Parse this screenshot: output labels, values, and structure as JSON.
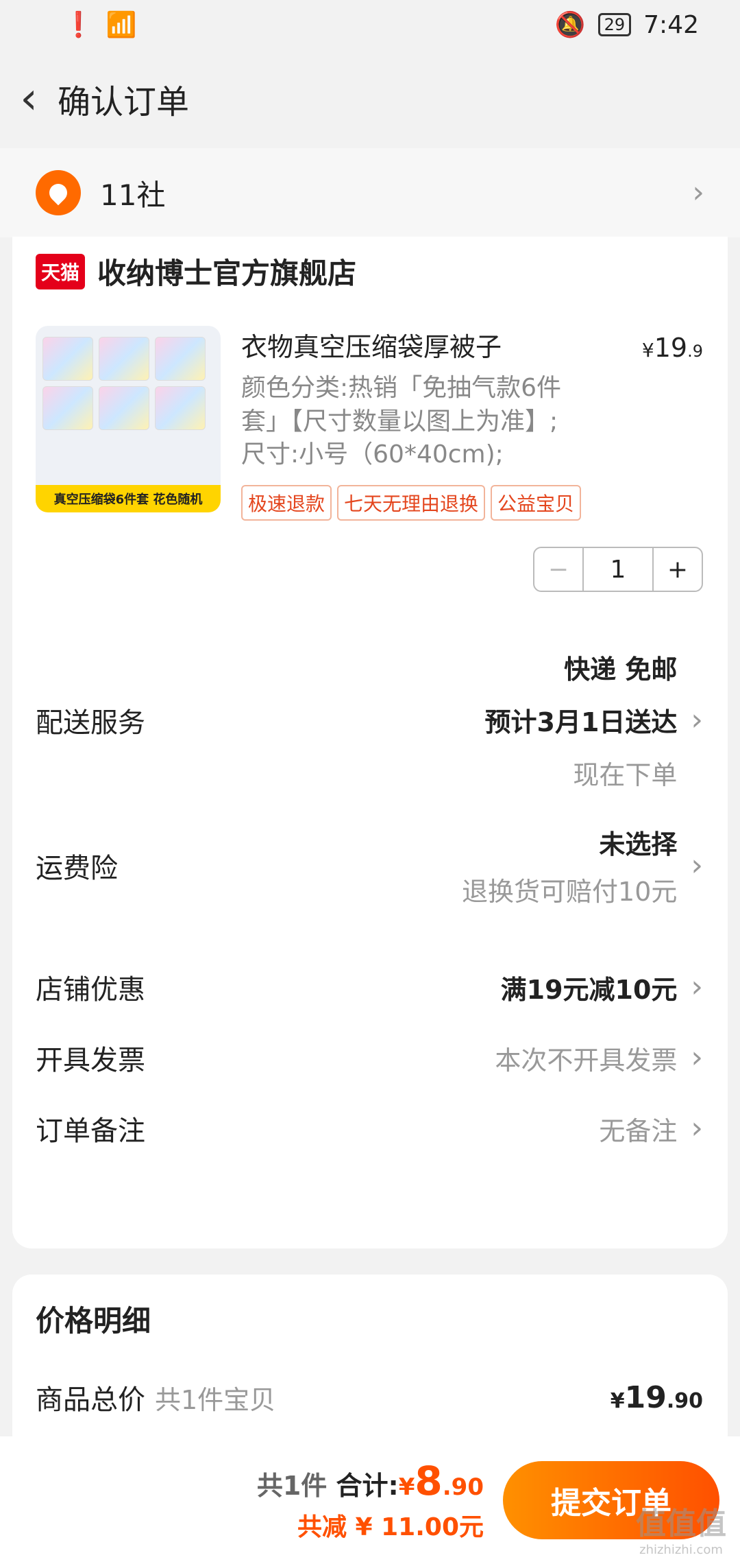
{
  "status": {
    "time": "7:42",
    "battery": "29"
  },
  "header": {
    "title": "确认订单"
  },
  "address": {
    "text": "11社"
  },
  "store": {
    "badge": "天猫",
    "name": "收纳博士官方旗舰店"
  },
  "product": {
    "title": "衣物真空压缩袋厚被子",
    "spec_line1": "颜色分类:热销「免抽气款6件",
    "spec_line2": "套」【尺寸数量以图上为准】;",
    "spec_line3": "尺寸:小号（60*40cm);",
    "price_symbol": "¥",
    "price_int": "19",
    "price_dec": ".9",
    "thumb_banner": "真空压缩袋6件套 花色随机",
    "tags": [
      "极速退款",
      "七天无理由退换",
      "公益宝贝"
    ],
    "quantity": "1",
    "minus": "−",
    "plus": "+"
  },
  "rows": {
    "delivery": {
      "label": "配送服务",
      "v1": "快递 免邮",
      "v2": "预计3月1日送达",
      "v3": "现在下单"
    },
    "insurance": {
      "label": "运费险",
      "v1": "未选择",
      "v2": "退换货可赔付10元"
    },
    "discount": {
      "label": "店铺优惠",
      "v1": "满19元减10元"
    },
    "invoice": {
      "label": "开具发票",
      "v1": "本次不开具发票"
    },
    "note": {
      "label": "订单备注",
      "v1": "无备注"
    }
  },
  "price_detail": {
    "title": "价格明细",
    "label": "商品总价",
    "sub": "共1件宝贝",
    "yen": "¥",
    "int": "19",
    "dec": ".90"
  },
  "bottom": {
    "count": "共1件",
    "total_label": "合计:",
    "yen": "¥",
    "total_int": "8",
    "total_dec": ".90",
    "saved": "共减 ¥ 11.00元",
    "submit": "提交订单"
  },
  "watermark": {
    "text": "值值值",
    "url": "zhizhizhi.com"
  }
}
